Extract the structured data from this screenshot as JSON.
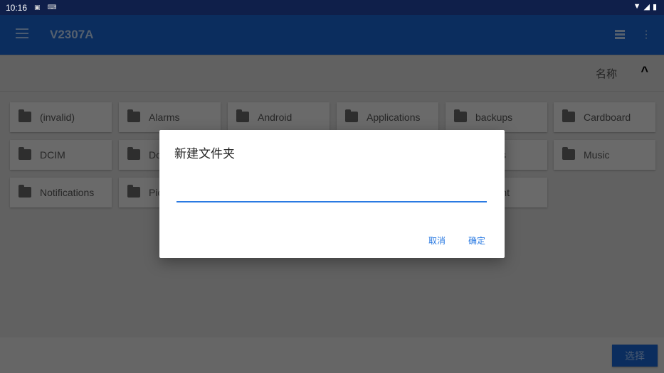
{
  "status_bar": {
    "time": "10:16",
    "icons": [
      "a11y-icon",
      "keyboard-icon",
      "wifi-icon",
      "signal-icon",
      "battery-icon"
    ]
  },
  "app_bar": {
    "title": "V2307A",
    "icons": [
      "menu-icon",
      "list-view-icon",
      "more-icon"
    ]
  },
  "sort": {
    "label": "名称",
    "direction": "ascending"
  },
  "folders": [
    {
      "name": "(invalid)"
    },
    {
      "name": "Alarms"
    },
    {
      "name": "Android"
    },
    {
      "name": "Applications"
    },
    {
      "name": "backups"
    },
    {
      "name": "Cardboard"
    },
    {
      "name": "DCIM"
    },
    {
      "name": "Do"
    },
    {
      "name": ""
    },
    {
      "name": ""
    },
    {
      "name": "s"
    },
    {
      "name": "Music"
    },
    {
      "name": "Notifications"
    },
    {
      "name": "Pic"
    },
    {
      "name": ""
    },
    {
      "name": ""
    },
    {
      "name": "nt"
    }
  ],
  "bottom": {
    "select_label": "选择"
  },
  "dialog": {
    "title": "新建文件夹",
    "input_value": "",
    "cancel_label": "取消",
    "ok_label": "确定",
    "accent": "#2a7ae2"
  }
}
